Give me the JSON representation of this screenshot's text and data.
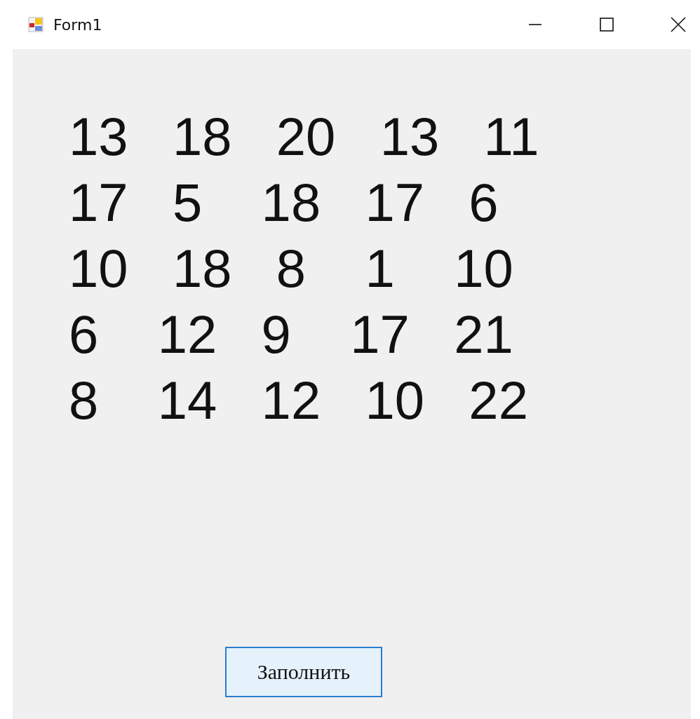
{
  "window": {
    "title": "Form1"
  },
  "label_lines": [
    "13   18   20   13   11",
    "17   5    18   17   6",
    "10   18   8    1    10",
    "6    12   9    17   21",
    "8    14   12   10   22"
  ],
  "button": {
    "label": "Заполнить",
    "focused": true
  }
}
